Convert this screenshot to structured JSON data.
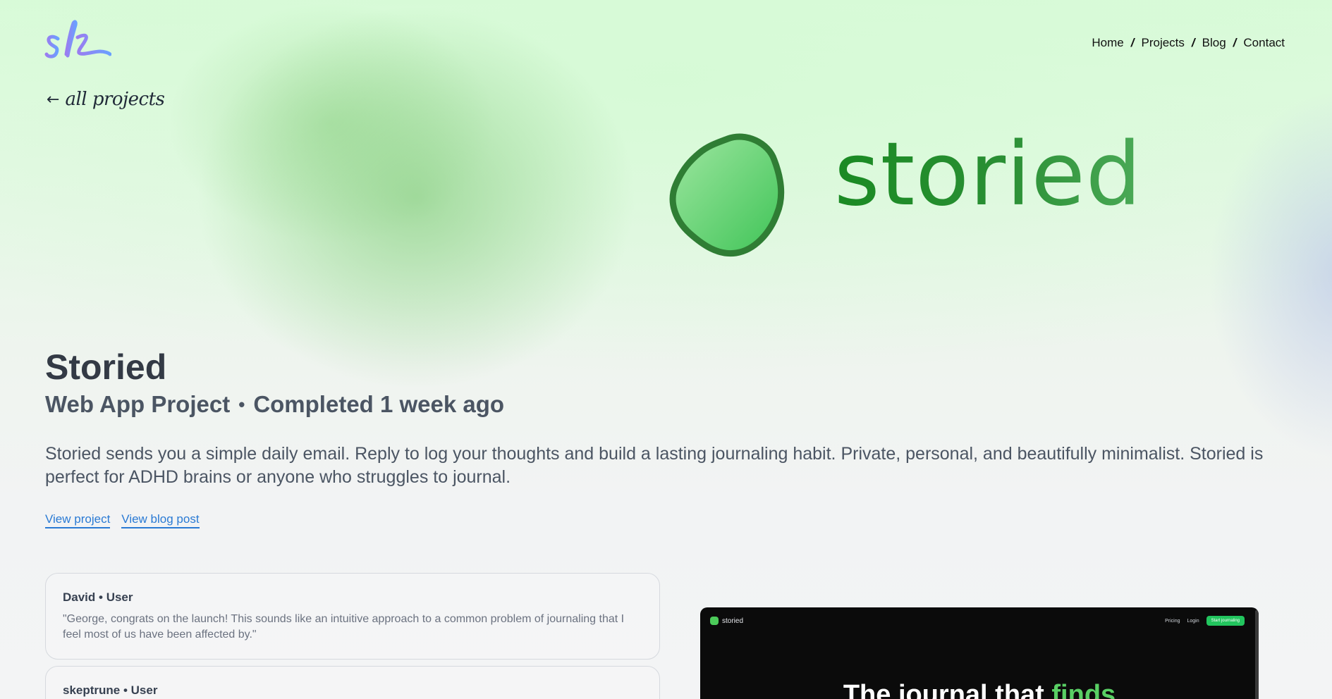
{
  "nav": {
    "items": [
      {
        "label": "Home"
      },
      {
        "label": "Projects"
      },
      {
        "label": "Blog"
      },
      {
        "label": "Contact"
      }
    ],
    "separator": "/"
  },
  "back_link": {
    "arrow": "←",
    "label": "all projects"
  },
  "hero": {
    "wordmark": "storied",
    "brand_color": "#2a8f34",
    "mark_color": "#4ccb5a"
  },
  "project": {
    "title": "Storied",
    "type": "Web App Project",
    "dot": "•",
    "status": "Completed 1 week ago",
    "description": "Storied sends you a simple daily email. Reply to log your thoughts and build a lasting journaling habit. Private, personal, and beautifully minimalist. Storied is perfect for ADHD brains or anyone who struggles to journal.",
    "links": {
      "view_project": "View project",
      "view_blog_post": "View blog post"
    },
    "link_color": "#2a7ad4"
  },
  "comments": [
    {
      "author": "David • User",
      "text": "\"George, congrats on the launch! This sounds like an intuitive approach to a common problem of journaling that I feel most of us have been affected by.\""
    },
    {
      "author": "skeptrune • User",
      "text": ""
    }
  ],
  "preview": {
    "logo_text": "storied",
    "nav_pricing": "Pricing",
    "nav_login": "Login",
    "cta": "Start journaling",
    "headline_main": "The journal that ",
    "headline_accent": "finds"
  }
}
